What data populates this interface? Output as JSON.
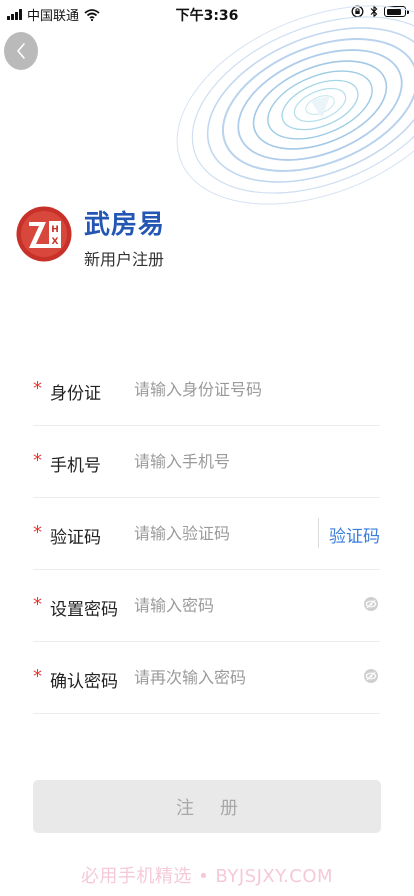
{
  "status_bar": {
    "carrier": "中国联通",
    "time": "下午3:36"
  },
  "header": {
    "app_title": "武房易",
    "subtitle": "新用户注册",
    "logo_text": "HX"
  },
  "icons": {
    "back": "chevron-left-icon",
    "eye": "eye-icon",
    "wifi": "wifi-icon",
    "bluetooth": "bluetooth-icon",
    "lock_rotation": "rotation-lock-icon",
    "battery": "battery-icon"
  },
  "form": {
    "required_mark": "*",
    "fields": [
      {
        "label": "身份证",
        "placeholder": "请输入身份证号码",
        "value": ""
      },
      {
        "label": "手机号",
        "placeholder": "请输入手机号",
        "value": ""
      },
      {
        "label": "验证码",
        "placeholder": "请输入验证码",
        "value": "",
        "action": "验证码"
      },
      {
        "label": "设置密码",
        "placeholder": "请输入密码",
        "value": ""
      },
      {
        "label": "确认密码",
        "placeholder": "请再次输入密码",
        "value": ""
      }
    ]
  },
  "submit": {
    "label": "注册"
  },
  "watermark": "必用手机精选 • BYJSJXY.COM",
  "colors": {
    "accent": "#3a7ddc",
    "title": "#2456b3",
    "required": "#e53935",
    "button_bg": "#e9e9e9",
    "logo_red": "#c8302a"
  }
}
